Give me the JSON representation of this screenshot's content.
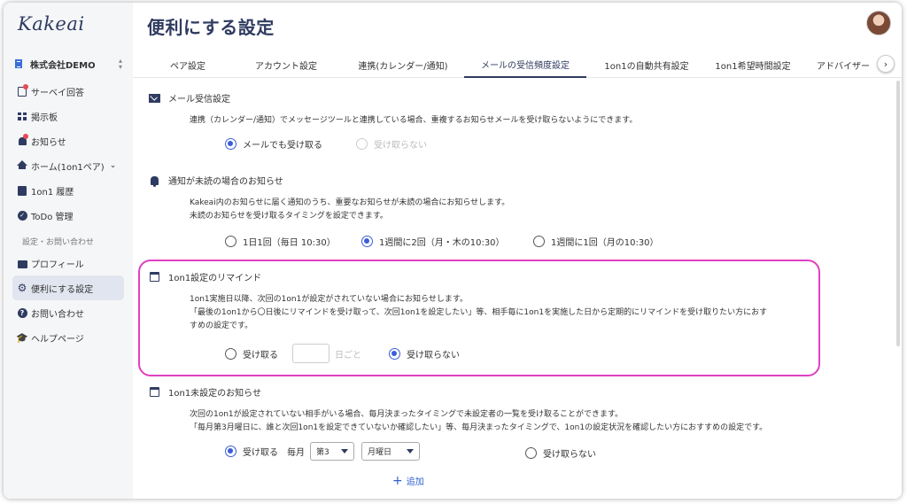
{
  "sidebar": {
    "logo": "Kakeai",
    "org": "株式会社DEMO",
    "items": [
      {
        "label": "サーベイ回答"
      },
      {
        "label": "掲示板"
      },
      {
        "label": "お知らせ"
      },
      {
        "label": "ホーム(1on1ペア)"
      },
      {
        "label": "1on1 履歴"
      },
      {
        "label": "ToDo 管理"
      }
    ],
    "section_label": "設定・お問い合わせ",
    "items2": [
      {
        "label": "プロフィール"
      },
      {
        "label": "便利にする設定"
      },
      {
        "label": "お問い合わせ"
      },
      {
        "label": "ヘルプページ"
      }
    ]
  },
  "header": {
    "title": "便利にする設定"
  },
  "tabs": [
    {
      "label": "ペア設定"
    },
    {
      "label": "アカウント設定"
    },
    {
      "label": "連携(カレンダー/通知)"
    },
    {
      "label": "メールの受信頻度設定"
    },
    {
      "label": "1on1の自動共有設定"
    },
    {
      "label": "1on1希望時間設定"
    },
    {
      "label": "アドバイザー"
    }
  ],
  "sections": {
    "mail": {
      "title": "メール受信設定",
      "desc": "連携（カレンダー/通知）でメッセージツールと連携している場合、重複するお知らせメールを受け取らないようにできます。",
      "opt_on": "メールでも受け取る",
      "opt_off": "受け取らない"
    },
    "unread": {
      "title": "通知が未読の場合のお知らせ",
      "desc1": "Kakeai内のお知らせに届く通知のうち、重要なお知らせが未読の場合にお知らせします。",
      "desc2": "未読のお知らせを受け取るタイミングを設定できます。",
      "opt1": "1日1回（毎日 10:30）",
      "opt2": "1週間に2回（月・木の10:30）",
      "opt3": "1週間に1回（月の10:30）"
    },
    "remind": {
      "title": "1on1設定のリマインド",
      "desc1": "1on1実施日以降、次回の1on1が設定がされていない場合にお知らせします。",
      "desc2": "「最後の1on1から〇日後にリマインドを受け取って、次回1on1を設定したい」等、相手毎に1on1を実施した日から定期的にリマインドを受け取りたい方におす",
      "desc3": "すめの設定です。",
      "opt_on": "受け取る",
      "unit": "日ごと",
      "opt_off": "受け取らない"
    },
    "unset": {
      "title": "1on1未設定のお知らせ",
      "desc1": "次回の1on1が設定されていない相手がいる場合、毎月決まったタイミングで未設定者の一覧を受け取ることができます。",
      "desc2": "「毎月第3月曜日に、誰と次回1on1を設定できていないか確認したい」等、毎月決まったタイミングで、1on1の設定状況を確認したい方におすすめの設定です。",
      "opt_on": "受け取る",
      "monthly": "毎月",
      "week_value": "第3",
      "day_value": "月曜日",
      "opt_off": "受け取らない",
      "add": "追加"
    }
  },
  "colors": {
    "navy": "#2f3b60",
    "accent_blue": "#3b5ed8",
    "highlight": "#e040c0"
  }
}
